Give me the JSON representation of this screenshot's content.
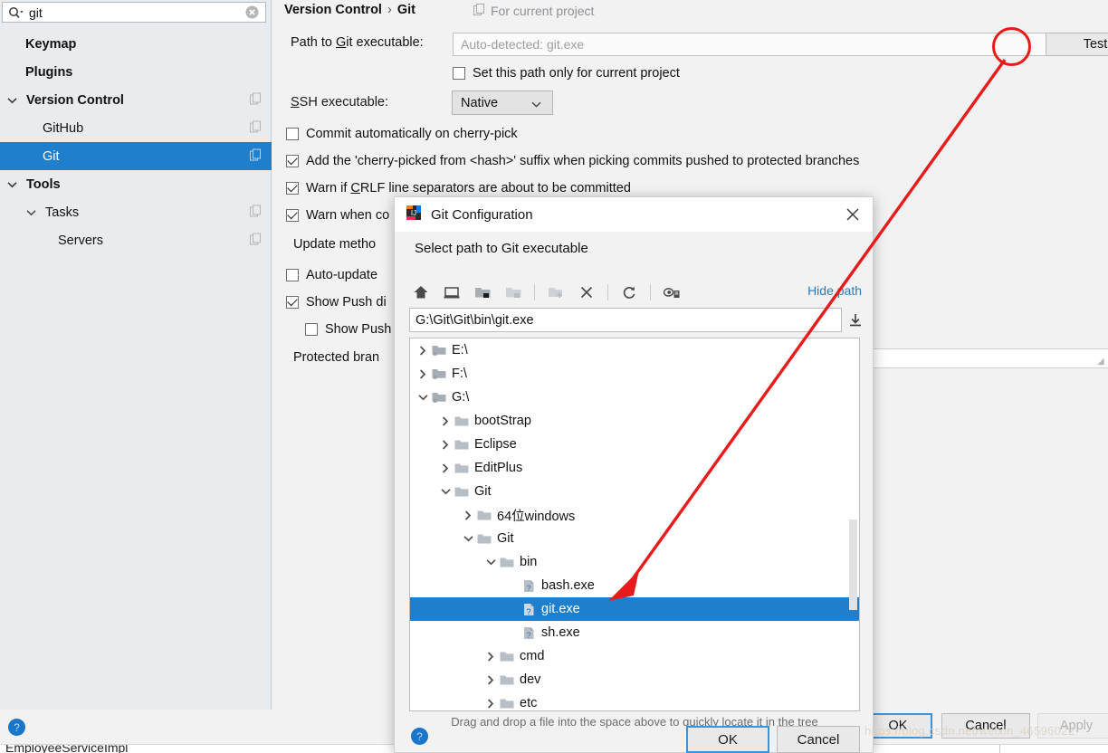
{
  "search": {
    "value": "git",
    "icon": "search-icon",
    "clear_icon": "clear-icon"
  },
  "sidebar": {
    "items": [
      {
        "label": "Keymap",
        "bold": true,
        "indent": 1,
        "twisty": "",
        "badge": false,
        "selected": false
      },
      {
        "label": "Plugins",
        "bold": true,
        "indent": 1,
        "twisty": "",
        "badge": false,
        "selected": false
      },
      {
        "label": "Version Control",
        "bold": true,
        "indent": 0,
        "twisty": "down",
        "badge": true,
        "selected": false
      },
      {
        "label": "GitHub",
        "bold": false,
        "indent": 1,
        "twisty": "",
        "badge": true,
        "selected": false
      },
      {
        "label": "Git",
        "bold": false,
        "indent": 1,
        "twisty": "",
        "badge": true,
        "selected": true
      },
      {
        "label": "Tools",
        "bold": true,
        "indent": 0,
        "twisty": "down",
        "badge": false,
        "selected": false
      },
      {
        "label": "Tasks",
        "bold": false,
        "indent": 1,
        "twisty": "down",
        "badge": true,
        "selected": false
      },
      {
        "label": "Servers",
        "bold": false,
        "indent": 2,
        "twisty": "",
        "badge": true,
        "selected": false
      }
    ],
    "help_icon": "help-icon"
  },
  "breadcrumb": {
    "root": "Version Control",
    "separator": "›",
    "current": "Git",
    "for_project": "For current project",
    "for_project_icon": "copy-icon"
  },
  "git_page": {
    "path_label": "Path to Git executable:",
    "path_label_mnemonic": "G",
    "path_placeholder": "Auto-detected: git.exe",
    "browse_label": "...",
    "test_label": "Test",
    "set_path_only": "Set this path only for current project",
    "set_path_only_checked": false,
    "ssh_label": "SSH executable:",
    "ssh_value": "Native",
    "checkboxes": [
      {
        "label": "Commit automatically on cherry-pick",
        "checked": false
      },
      {
        "label": "Add the 'cherry-picked from <hash>' suffix when picking commits pushed to protected branches",
        "checked": true
      },
      {
        "label": "Warn if CRLF line separators are about to be committed",
        "checked": true
      },
      {
        "label": "Warn when co",
        "checked": true
      },
      {
        "label": "Auto-update",
        "checked": false
      },
      {
        "label": "Show Push di",
        "checked": true
      },
      {
        "label": "Show Push",
        "checked": false
      }
    ],
    "update_method_label": "Update metho",
    "protected_branches_label": "Protected bran"
  },
  "settings_buttons": {
    "ok": "OK",
    "cancel": "Cancel",
    "apply": "Apply"
  },
  "dialog": {
    "title": "Git Configuration",
    "title_icon": "intellij-icon",
    "close_icon": "close-icon",
    "subtitle": "Select path to Git executable",
    "toolbar": [
      {
        "name": "home-icon"
      },
      {
        "name": "desktop-icon"
      },
      {
        "name": "project-folder-icon"
      },
      {
        "name": "module-folder-icon"
      },
      {
        "name": "new-folder-icon"
      },
      {
        "name": "delete-icon"
      },
      {
        "name": "refresh-icon"
      },
      {
        "name": "show-hidden-icon"
      }
    ],
    "hide_path_label": "Hide path",
    "path_value": "G:\\Git\\Git\\bin\\git.exe",
    "download_icon": "download-icon",
    "tree": [
      {
        "label": "E:\\",
        "depth": 0,
        "twisty": "right",
        "icon": "drive-icon",
        "selected": false
      },
      {
        "label": "F:\\",
        "depth": 0,
        "twisty": "right",
        "icon": "drive-icon",
        "selected": false
      },
      {
        "label": "G:\\",
        "depth": 0,
        "twisty": "down",
        "icon": "drive-icon",
        "selected": false
      },
      {
        "label": "bootStrap",
        "depth": 1,
        "twisty": "right",
        "icon": "folder-icon",
        "selected": false
      },
      {
        "label": "Eclipse",
        "depth": 1,
        "twisty": "right",
        "icon": "folder-icon",
        "selected": false
      },
      {
        "label": "EditPlus",
        "depth": 1,
        "twisty": "right",
        "icon": "folder-icon",
        "selected": false
      },
      {
        "label": "Git",
        "depth": 1,
        "twisty": "down",
        "icon": "folder-icon",
        "selected": false
      },
      {
        "label": "64位windows",
        "depth": 2,
        "twisty": "right",
        "icon": "folder-icon",
        "selected": false
      },
      {
        "label": "Git",
        "depth": 2,
        "twisty": "down",
        "icon": "folder-icon",
        "selected": false
      },
      {
        "label": "bin",
        "depth": 3,
        "twisty": "down",
        "icon": "folder-icon",
        "selected": false
      },
      {
        "label": "bash.exe",
        "depth": 4,
        "twisty": "",
        "icon": "unknown-file-icon",
        "selected": false
      },
      {
        "label": "git.exe",
        "depth": 4,
        "twisty": "",
        "icon": "unknown-file-icon",
        "selected": true
      },
      {
        "label": "sh.exe",
        "depth": 4,
        "twisty": "",
        "icon": "unknown-file-icon",
        "selected": false
      },
      {
        "label": "cmd",
        "depth": 3,
        "twisty": "right",
        "icon": "folder-icon",
        "selected": false
      },
      {
        "label": "dev",
        "depth": 3,
        "twisty": "right",
        "icon": "folder-icon",
        "selected": false
      },
      {
        "label": "etc",
        "depth": 3,
        "twisty": "right",
        "icon": "folder-icon",
        "selected": false
      }
    ],
    "hint": "Drag and drop a file into the space above to quickly locate it in the tree",
    "help_icon": "help-icon",
    "ok": "OK",
    "cancel": "Cancel"
  },
  "editor_strip": {
    "text": "EmployeeServiceImpl"
  },
  "watermark": {
    "text": "https://blog.csdn.net/weixin_46596022"
  },
  "colors": {
    "selection_blue": "#1f7fcd",
    "accent_focus": "#3b93d9",
    "annotation_red": "#e81b1b",
    "link_blue": "#2a7ab8"
  }
}
